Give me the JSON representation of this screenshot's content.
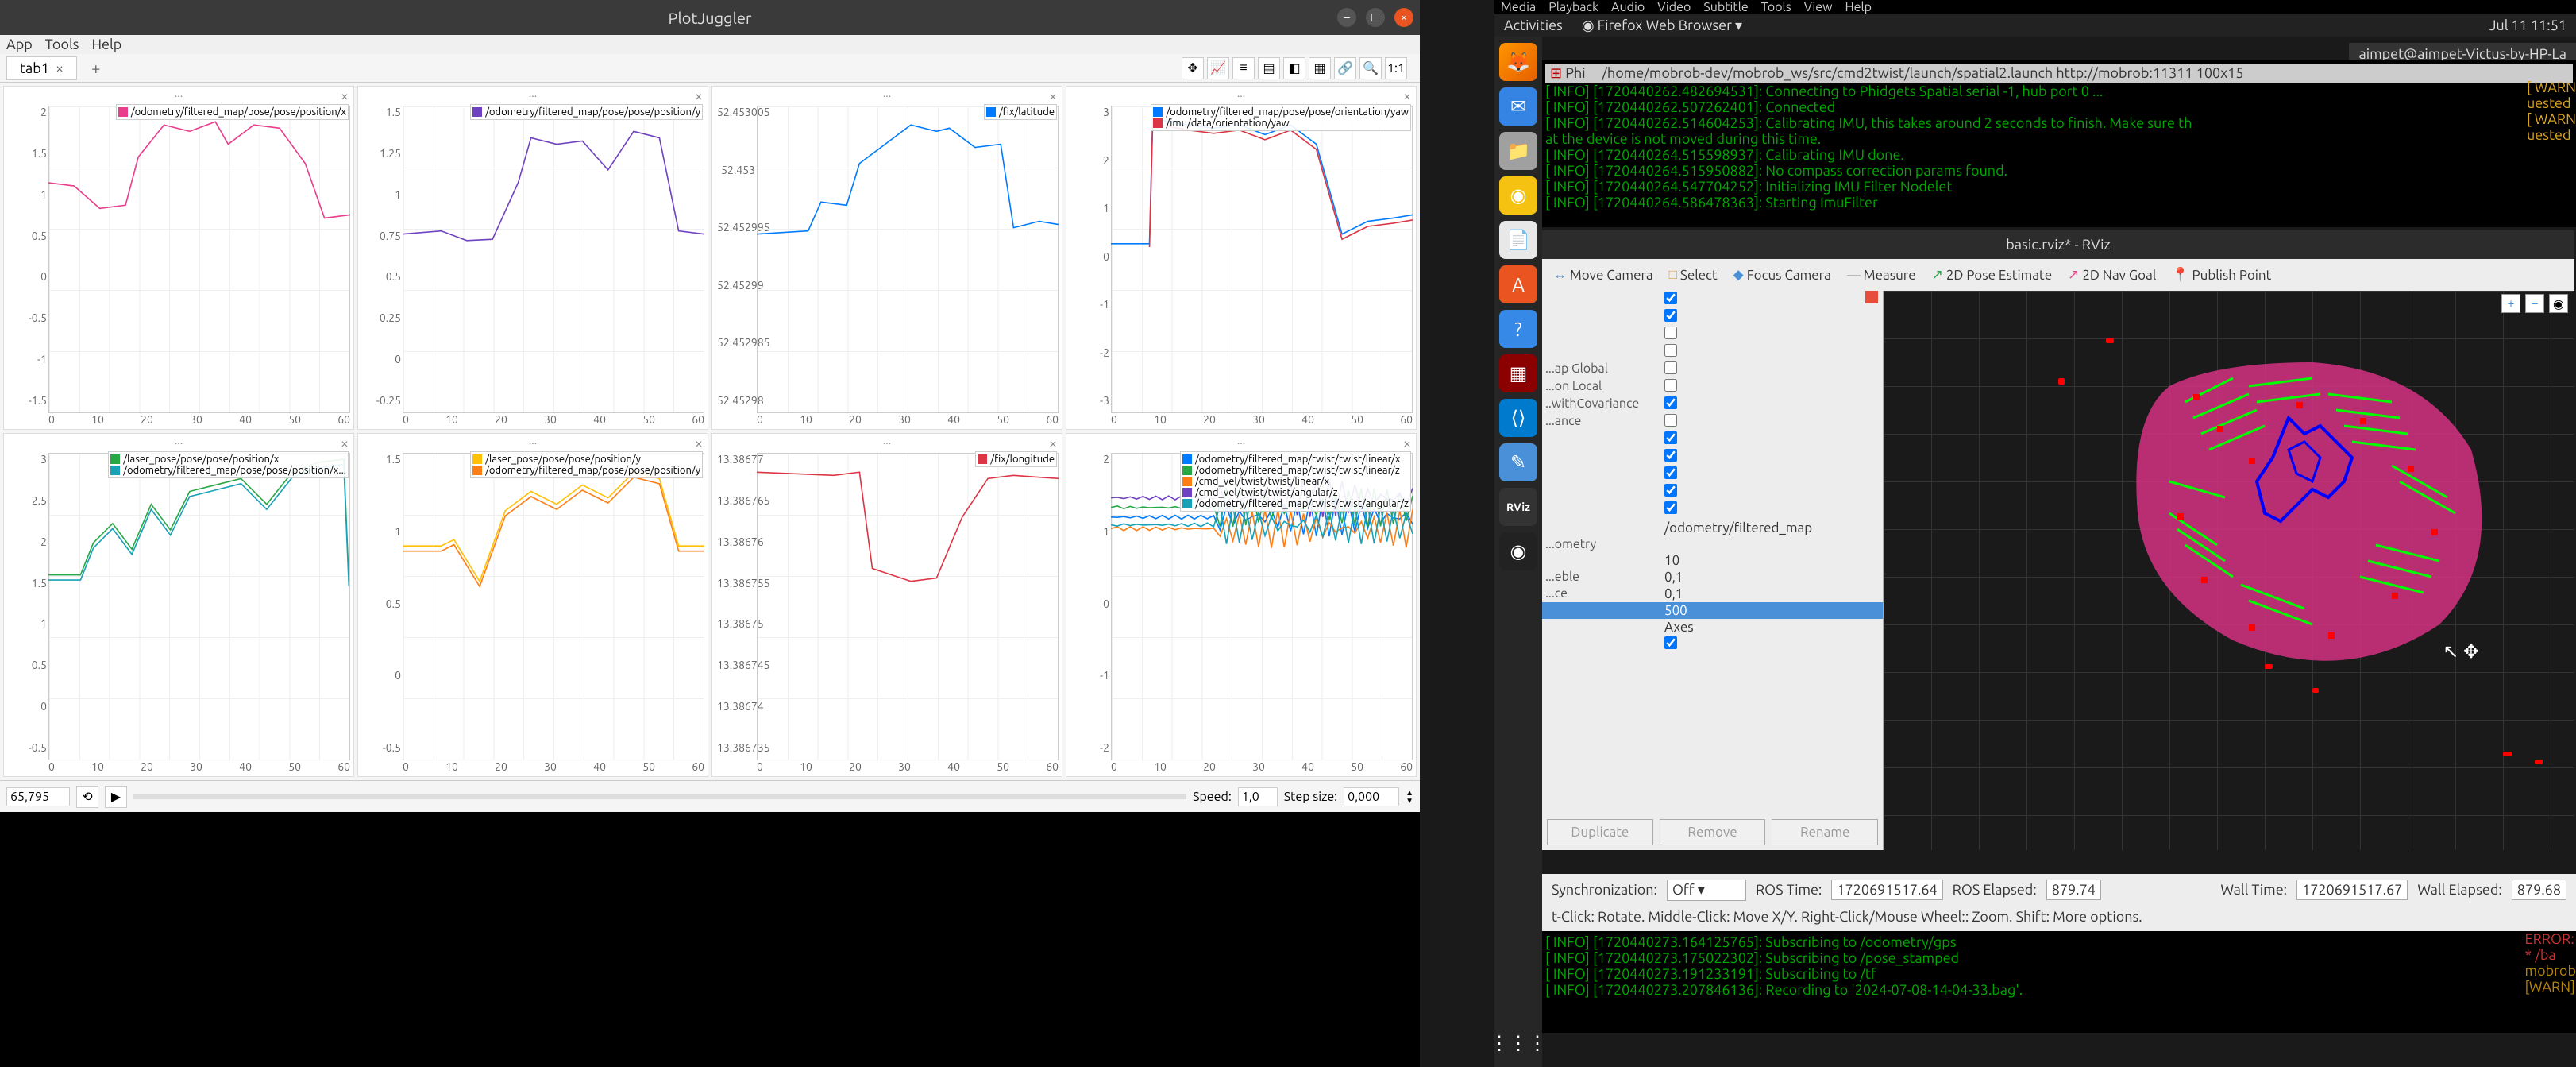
{
  "plotjuggler": {
    "title": "PlotJuggler",
    "menus": [
      "App",
      "Tools",
      "Help"
    ],
    "tab": "tab1",
    "toolbar_icons": [
      "move",
      "chart",
      "list",
      "sheet",
      "legend",
      "grid",
      "link",
      "zoom",
      "1:1"
    ],
    "footer": {
      "time": "65,795",
      "speed_label": "Speed:",
      "speed": "1,0",
      "step_label": "Step size:",
      "step": "0,000"
    },
    "x_ticks": [
      "0",
      "10",
      "20",
      "30",
      "40",
      "50",
      "60"
    ],
    "plots": [
      {
        "title": "...",
        "legend": [
          {
            "label": "/odometry/filtered_map/pose/pose/position/x",
            "color": "#e83e8c"
          }
        ],
        "y_ticks": [
          "2",
          "1.5",
          "1",
          "0.5",
          "0",
          "-0.5",
          "-1",
          "-1.5"
        ]
      },
      {
        "title": "...",
        "legend": [
          {
            "label": "/odometry/filtered_map/pose/pose/position/y",
            "color": "#6f42c1"
          }
        ],
        "y_ticks": [
          "1.5",
          "1.25",
          "1",
          "0.75",
          "0.5",
          "0.25",
          "0",
          "-0.25"
        ]
      },
      {
        "title": "...",
        "legend": [
          {
            "label": "/fix/latitude",
            "color": "#007bff"
          }
        ],
        "y_ticks": [
          "52.453005",
          "52.453",
          "52.452995",
          "52.45299",
          "52.452985",
          "52.45298"
        ]
      },
      {
        "title": "...",
        "legend": [
          {
            "label": "/odometry/filtered_map/pose/pose/orientation/yaw",
            "color": "#007bff"
          },
          {
            "label": "/imu/data/orientation/yaw",
            "color": "#dc3545"
          }
        ],
        "y_ticks": [
          "3",
          "2",
          "1",
          "0",
          "-1",
          "-2",
          "-3"
        ]
      },
      {
        "title": "...",
        "legend": [
          {
            "label": "/laser_pose/pose/pose/position/x",
            "color": "#28a745"
          },
          {
            "label": "/odometry/filtered_map/pose/pose/position/x...",
            "color": "#17a2b8"
          }
        ],
        "y_ticks": [
          "3",
          "2.5",
          "2",
          "1.5",
          "1",
          "0.5",
          "0",
          "-0.5"
        ]
      },
      {
        "title": "...",
        "legend": [
          {
            "label": "/laser_pose/pose/pose/position/y",
            "color": "#ffc107"
          },
          {
            "label": "/odometry/filtered_map/pose/pose/position/y",
            "color": "#fd7e14"
          }
        ],
        "y_ticks": [
          "1.5",
          "1",
          "0.5",
          "0",
          "-0.5"
        ]
      },
      {
        "title": "...",
        "legend": [
          {
            "label": "/fix/longitude",
            "color": "#dc3545"
          }
        ],
        "y_ticks": [
          "13.38677",
          "13.386765",
          "13.38676",
          "13.386755",
          "13.38675",
          "13.386745",
          "13.38674",
          "13.386735"
        ]
      },
      {
        "title": "...",
        "legend": [
          {
            "label": "/odometry/filtered_map/twist/twist/linear/x",
            "color": "#007bff"
          },
          {
            "label": "/odometry/filtered_map/twist/twist/linear/z",
            "color": "#28a745"
          },
          {
            "label": "/cmd_vel/twist/twist/linear/x",
            "color": "#fd7e14"
          },
          {
            "label": "/cmd_vel/twist/twist/angular/z",
            "color": "#6f42c1"
          },
          {
            "label": "/odometry/filtered_map/twist/twist/angular/z",
            "color": "#17a2b8"
          }
        ],
        "y_ticks": [
          "2",
          "1",
          "0",
          "-1",
          "-2"
        ]
      }
    ]
  },
  "gnome": {
    "menus": [
      "Media",
      "Playback",
      "Audio",
      "Video",
      "Subtitle",
      "Tools",
      "View",
      "Help"
    ],
    "activities": "Activities",
    "app": "Firefox Web Browser",
    "clock": "Jul 11 11:51",
    "user": "aimpet@aimpet-Victus-by-HP-La"
  },
  "term_top": {
    "path_prefix": "Phi",
    "path": "/home/mobrob-dev/mobrob_ws/src/cmd2twist/launch/spatial2.launch http://mobrob:11311 100x15",
    "lines": [
      "[ INFO] [1720440262.482694531]: Connecting to Phidgets Spatial serial -1, hub port 0 ...",
      "[ INFO] [1720440262.507262401]: Connected",
      "[ INFO] [1720440262.514604253]: Calibrating IMU, this takes around 2 seconds to finish. Make sure th",
      "at the device is not moved during this time.",
      "[ INFO] [1720440264.515598937]: Calibrating IMU done.",
      "[ INFO] [1720440264.515950882]: No compass correction params found.",
      "[ INFO] [1720440264.547704252]: Initializing IMU Filter Nodelet",
      "[ INFO] [1720440264.586478363]: Starting ImuFilter"
    ],
    "warns": [
      "[ WARN",
      "uested",
      "",
      "[ WARN",
      "uested"
    ]
  },
  "rviz": {
    "title": "basic.rviz* - RViz",
    "tools": [
      {
        "icon": "↔",
        "label": "Move Camera",
        "color": "#4a90d9"
      },
      {
        "icon": "□",
        "label": "Select",
        "color": "#d9a04a"
      },
      {
        "icon": "◆",
        "label": "Focus Camera",
        "color": "#4a90d9"
      },
      {
        "icon": "—",
        "label": "Measure",
        "color": "#999"
      },
      {
        "icon": "↗",
        "label": "2D Pose Estimate",
        "color": "#28a745"
      },
      {
        "icon": "↗",
        "label": "2D Nav Goal",
        "color": "#e83e8c"
      },
      {
        "icon": "📍",
        "label": "Publish Point",
        "color": "#dc3545"
      }
    ],
    "tree_labels": [
      "",
      "",
      "",
      "",
      "...ap Global",
      "...on Local",
      "..withCovariance",
      "...ance",
      "",
      "",
      "",
      "",
      "",
      "",
      "",
      "...ometry",
      "",
      "...eble",
      "...ce",
      "",
      "",
      "",
      "",
      ""
    ],
    "tree_values": [
      {
        "type": "check",
        "checked": true
      },
      {
        "type": "check",
        "checked": true
      },
      {
        "type": "check",
        "checked": false
      },
      {
        "type": "check",
        "checked": false
      },
      {
        "type": "check",
        "checked": false
      },
      {
        "type": "check",
        "checked": false
      },
      {
        "type": "check",
        "checked": true
      },
      {
        "type": "check",
        "checked": false
      },
      {
        "type": "check",
        "checked": true
      },
      {
        "type": "check",
        "checked": true
      },
      {
        "type": "check",
        "checked": true
      },
      {
        "type": "check",
        "checked": true
      },
      {
        "type": "check",
        "checked": true
      },
      {
        "type": "text",
        "value": ""
      },
      {
        "type": "text",
        "value": "/odometry/filtered_map"
      },
      {
        "type": "text",
        "value": ""
      },
      {
        "type": "text",
        "value": "10"
      },
      {
        "type": "text",
        "value": "0,1"
      },
      {
        "type": "text",
        "value": "0,1"
      },
      {
        "type": "text",
        "value": "500",
        "selected": true
      },
      {
        "type": "text",
        "value": "Axes"
      },
      {
        "type": "check",
        "checked": true
      }
    ],
    "buttons": [
      "Duplicate",
      "Remove",
      "Rename"
    ],
    "status": {
      "sync_label": "Synchronization:",
      "sync": "Off",
      "ros_time_label": "ROS Time:",
      "ros_time": "1720691517.64",
      "ros_elapsed_label": "ROS Elapsed:",
      "ros_elapsed": "879.74",
      "wall_time_label": "Wall Time:",
      "wall_time": "1720691517.67",
      "wall_elapsed_label": "Wall Elapsed:",
      "wall_elapsed": "879.68"
    },
    "help": "t-Click: Rotate. Middle-Click: Move X/Y. Right-Click/Mouse Wheel:: Zoom. Shift: More options."
  },
  "term_bottom": {
    "lines": [
      "[ INFO] [1720440273.164125765]: Subscribing to /odometry/gps",
      "[ INFO] [1720440273.175022302]: Subscribing to /pose_stamped",
      "[ INFO] [1720440273.191233191]: Subscribing to /tf",
      "[ INFO] [1720440273.207846136]: Recording to '2024-07-08-14-04-33.bag'."
    ],
    "right": [
      "ERROR:",
      " * /ba",
      "mobrob",
      "[WARN]"
    ]
  }
}
